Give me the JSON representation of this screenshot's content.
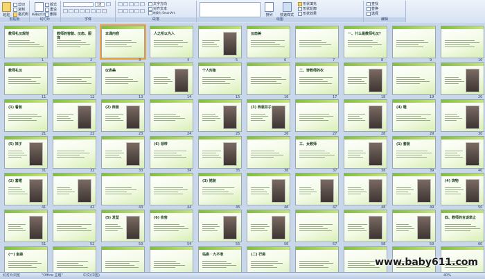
{
  "ribbon": {
    "groups": [
      {
        "label": "剪贴板"
      },
      {
        "label": "幻灯片"
      },
      {
        "label": "字体"
      },
      {
        "label": "段落"
      },
      {
        "label": "绘图"
      },
      {
        "label": "编辑"
      }
    ],
    "buttons": {
      "paste": "粘贴",
      "cut": "剪切",
      "copy": "复制",
      "format_painter": "格式刷",
      "new_slide": "新建幻灯片",
      "layout": "版式",
      "reset": "重设",
      "delete": "删除",
      "text_direction": "文字方向",
      "align_text": "对齐文本",
      "smartart": "转换为 SmartArt",
      "arrange": "排列",
      "quick_styles": "快速样式",
      "shape_fill": "形状填充",
      "shape_outline": "形状轮廓",
      "shape_effects": "形状效果",
      "find": "查找",
      "replace": "替换",
      "select": "选择"
    },
    "font_name": "",
    "font_size": "18"
  },
  "slides": [
    {
      "n": "1",
      "title": "教师礼仪规范",
      "pic": false
    },
    {
      "n": "2",
      "title": "教师的容貌、仪态、服饰",
      "pic": false
    },
    {
      "n": "3",
      "title": "本课内容",
      "pic": false,
      "sel": true
    },
    {
      "n": "4",
      "title": "人之所以为人",
      "pic": false
    },
    {
      "n": "5",
      "title": "",
      "pic": true
    },
    {
      "n": "6",
      "title": "仪态美",
      "pic": false
    },
    {
      "n": "7",
      "title": "",
      "pic": false
    },
    {
      "n": "8",
      "title": "一、什么是教师礼仪？",
      "pic": false
    },
    {
      "n": "9",
      "title": "",
      "pic": false
    },
    {
      "n": "10",
      "title": "",
      "pic": false
    },
    {
      "n": "11",
      "title": "教师礼仪",
      "pic": false
    },
    {
      "n": "12",
      "title": "",
      "pic": false
    },
    {
      "n": "13",
      "title": "仪表美",
      "pic": false
    },
    {
      "n": "14",
      "title": "",
      "pic": true
    },
    {
      "n": "15",
      "title": "个人形象",
      "pic": false
    },
    {
      "n": "16",
      "title": "",
      "pic": false
    },
    {
      "n": "17",
      "title": "二、穿教师的衣",
      "pic": false
    },
    {
      "n": "18",
      "title": "",
      "pic": true
    },
    {
      "n": "19",
      "title": "",
      "pic": false
    },
    {
      "n": "20",
      "title": "",
      "pic": true
    },
    {
      "n": "21",
      "title": "(1) 着装",
      "pic": false
    },
    {
      "n": "22",
      "title": "",
      "pic": true
    },
    {
      "n": "23",
      "title": "(2) 西装",
      "pic": true
    },
    {
      "n": "24",
      "title": "",
      "pic": false
    },
    {
      "n": "25",
      "title": "",
      "pic": true
    },
    {
      "n": "26",
      "title": "(3) 西装扣子",
      "pic": true
    },
    {
      "n": "27",
      "title": "",
      "pic": false
    },
    {
      "n": "28",
      "title": "",
      "pic": true
    },
    {
      "n": "29",
      "title": "(4) 鞋",
      "pic": false
    },
    {
      "n": "30",
      "title": "",
      "pic": true
    },
    {
      "n": "31",
      "title": "(5) 袜子",
      "pic": true
    },
    {
      "n": "32",
      "title": "",
      "pic": false
    },
    {
      "n": "33",
      "title": "",
      "pic": true
    },
    {
      "n": "34",
      "title": "(6) 领带",
      "pic": false
    },
    {
      "n": "35",
      "title": "",
      "pic": true
    },
    {
      "n": "36",
      "title": "",
      "pic": false
    },
    {
      "n": "37",
      "title": "三、女教师",
      "pic": false
    },
    {
      "n": "38",
      "title": "",
      "pic": true
    },
    {
      "n": "39",
      "title": "(1) 套装",
      "pic": false
    },
    {
      "n": "40",
      "title": "",
      "pic": true
    },
    {
      "n": "41",
      "title": "(2) 套裙",
      "pic": true
    },
    {
      "n": "42",
      "title": "",
      "pic": true
    },
    {
      "n": "43",
      "title": "",
      "pic": false
    },
    {
      "n": "44",
      "title": "",
      "pic": false
    },
    {
      "n": "45",
      "title": "(3) 裙装",
      "pic": false
    },
    {
      "n": "46",
      "title": "",
      "pic": true
    },
    {
      "n": "47",
      "title": "",
      "pic": true
    },
    {
      "n": "48",
      "title": "",
      "pic": true
    },
    {
      "n": "49",
      "title": "",
      "pic": true
    },
    {
      "n": "50",
      "title": "(4) 饰物",
      "pic": true
    },
    {
      "n": "51",
      "title": "",
      "pic": true
    },
    {
      "n": "52",
      "title": "",
      "pic": false
    },
    {
      "n": "53",
      "title": "(5) 发型",
      "pic": true
    },
    {
      "n": "54",
      "title": "(6) 妆容",
      "pic": false
    },
    {
      "n": "55",
      "title": "",
      "pic": true
    },
    {
      "n": "56",
      "title": "",
      "pic": true
    },
    {
      "n": "57",
      "title": "",
      "pic": false
    },
    {
      "n": "58",
      "title": "",
      "pic": true
    },
    {
      "n": "59",
      "title": "",
      "pic": true
    },
    {
      "n": "60",
      "title": "四、教师的言谈举止",
      "pic": false
    },
    {
      "n": "61",
      "title": "(一) 坐姿",
      "pic": false
    },
    {
      "n": "62",
      "title": "",
      "pic": false
    },
    {
      "n": "63",
      "title": "",
      "pic": false
    },
    {
      "n": "64",
      "title": "",
      "pic": false
    },
    {
      "n": "65",
      "title": "站姿 · 九不准",
      "pic": false
    },
    {
      "n": "66",
      "title": "(二) 行姿",
      "pic": false
    },
    {
      "n": "67",
      "title": "",
      "pic": false
    },
    {
      "n": "68",
      "title": "",
      "pic": false
    },
    {
      "n": "69",
      "title": "",
      "pic": false
    },
    {
      "n": "70",
      "title": "",
      "pic": false
    }
  ],
  "status": {
    "view": "幻灯片浏览",
    "theme": "\"Office 主题\"",
    "language": "中文(中国)",
    "zoom": "40%"
  },
  "watermark": "www.baby611.com"
}
